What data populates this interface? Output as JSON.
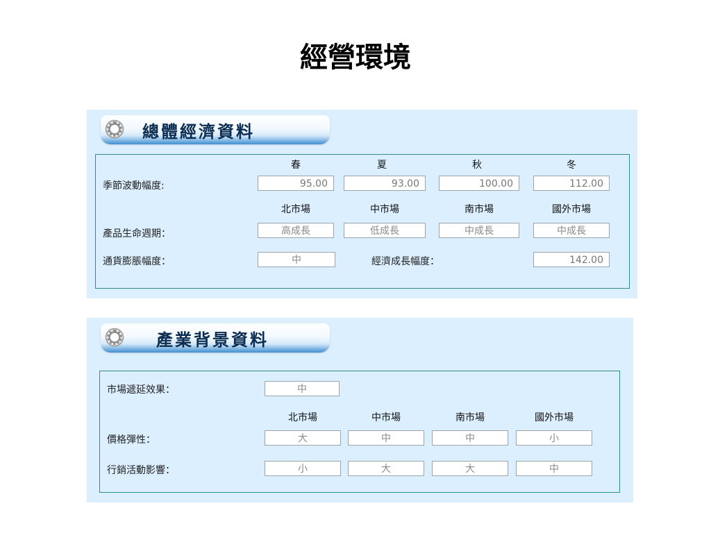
{
  "page": {
    "title": "經營環境"
  },
  "economy": {
    "title": "總體經濟資料",
    "season_headers": [
      "春",
      "夏",
      "秋",
      "冬"
    ],
    "seasonal_label": "季節波動幅度:",
    "seasonal_values": [
      "95.00",
      "93.00",
      "100.00",
      "112.00"
    ],
    "market_headers": [
      "北市場",
      "中市場",
      "南市場",
      "國外市場"
    ],
    "lifecycle_label": "產品生命週期：",
    "lifecycle_values": [
      "高成長",
      "低成長",
      "中成長",
      "中成長"
    ],
    "inflation_label": "通貨膨脹幅度：",
    "inflation_value": "中",
    "growth_label": "經濟成長幅度：",
    "growth_value": "142.00"
  },
  "industry": {
    "title": "產業背景資料",
    "lag_label": "市場遞延效果：",
    "lag_value": "中",
    "market_headers": [
      "北市場",
      "中市場",
      "南市場",
      "國外市場"
    ],
    "elasticity_label": "價格彈性：",
    "elasticity_values": [
      "大",
      "中",
      "中",
      "小"
    ],
    "marketing_label": "行銷活動影響：",
    "marketing_values": [
      "小",
      "大",
      "大",
      "中"
    ]
  },
  "colors": {
    "panel_bg": "#dcefff",
    "border": "#2f8f86",
    "title_text": "#0b2d52"
  },
  "icons": [
    "gear-icon"
  ]
}
